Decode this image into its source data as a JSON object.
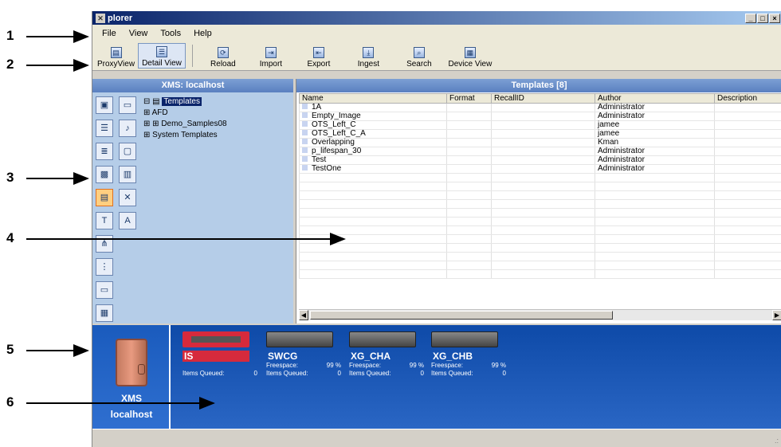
{
  "callouts": [
    "1",
    "2",
    "3",
    "4",
    "5",
    "6"
  ],
  "window": {
    "title": "plorer",
    "minimize": "_",
    "maximize": "□",
    "close": "×"
  },
  "menu": [
    "File",
    "View",
    "Tools",
    "Help"
  ],
  "toolbar": [
    {
      "label": "ProxyView",
      "icon": "proxy-view-icon",
      "glyph": "▤"
    },
    {
      "label": "Detail View",
      "icon": "detail-view-icon",
      "glyph": "☰"
    },
    {
      "label": "Reload",
      "icon": "reload-icon",
      "glyph": "⟳"
    },
    {
      "label": "Import",
      "icon": "import-icon",
      "glyph": "⇥"
    },
    {
      "label": "Export",
      "icon": "export-icon",
      "glyph": "⇤"
    },
    {
      "label": "Ingest",
      "icon": "ingest-icon",
      "glyph": "⤓"
    },
    {
      "label": "Search",
      "icon": "search-icon",
      "glyph": "⌕"
    },
    {
      "label": "Device View",
      "icon": "device-view-icon",
      "glyph": "▦"
    }
  ],
  "left_pane": {
    "header": "XMS: localhost",
    "tree": [
      {
        "prefix": "⊟ ▤ ",
        "label": "Templates",
        "selected": true
      },
      {
        "prefix": "    ⊞ ",
        "label": "AFD"
      },
      {
        "prefix": "  ⊞ ⊞ ",
        "label": "Demo_Samples08"
      },
      {
        "prefix": "    ⊞ ",
        "label": "System Templates"
      }
    ]
  },
  "right_pane": {
    "header": "Templates [8]",
    "columns": [
      "Name",
      "Format",
      "RecallID",
      "Author",
      "Description"
    ],
    "rows": [
      [
        "1A",
        "",
        "",
        "Administrator",
        ""
      ],
      [
        "Empty_Image",
        "",
        "",
        "Administrator",
        ""
      ],
      [
        "OTS_Left_C",
        "",
        "",
        "jamee",
        ""
      ],
      [
        "OTS_Left_C_A",
        "",
        "",
        "jamee",
        ""
      ],
      [
        "Overlapping",
        "",
        "",
        "Kman",
        ""
      ],
      [
        "p_lifespan_30",
        "",
        "",
        "Administrator",
        ""
      ],
      [
        "Test",
        "",
        "",
        "Administrator",
        ""
      ],
      [
        "TestOne",
        "",
        "",
        "Administrator",
        ""
      ]
    ]
  },
  "xms": {
    "name": "XMS",
    "host": "localhost"
  },
  "devices": [
    {
      "name": "IS",
      "freespace_label": "",
      "freespace": "",
      "queued_label": "Items Queued:",
      "queued": "0",
      "selected": true
    },
    {
      "name": "SWCG",
      "freespace_label": "Freespace:",
      "freespace": "99 %",
      "queued_label": "Items Queued:",
      "queued": "0"
    },
    {
      "name": "XG_CHA",
      "freespace_label": "Freespace:",
      "freespace": "99 %",
      "queued_label": "Items Queued:",
      "queued": "0"
    },
    {
      "name": "XG_CHB",
      "freespace_label": "Freespace:",
      "freespace": "99 %",
      "queued_label": "Items Queued:",
      "queued": "0"
    }
  ],
  "statusbar": {
    "grip": ".:"
  }
}
